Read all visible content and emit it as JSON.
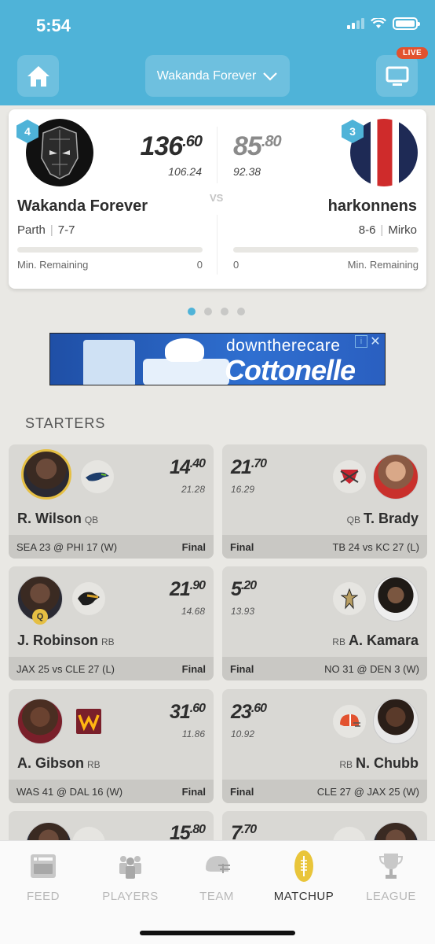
{
  "status": {
    "time": "5:54"
  },
  "header": {
    "team_select": "Wakanda Forever",
    "live_badge": "LIVE"
  },
  "matchup": {
    "vs": "VS",
    "left": {
      "rank": "4",
      "score_int": "136",
      "score_dec": ".60",
      "projected": "106.24",
      "name": "Wakanda Forever",
      "owner": "Parth",
      "record": "7-7",
      "remaining_label": "Min. Remaining",
      "remaining": "0"
    },
    "right": {
      "rank": "3",
      "score_int": "85",
      "score_dec": ".80",
      "projected": "92.38",
      "name": "harkonnens",
      "owner": "Mirko",
      "record": "8-6",
      "remaining_label": "Min. Remaining",
      "remaining": "0"
    }
  },
  "ad": {
    "line1": "downtherecare",
    "line2": "Cottonelle",
    "info": "i",
    "close": "✕"
  },
  "section": {
    "starters": "STARTERS"
  },
  "starters": [
    {
      "left": {
        "name": "R. Wilson",
        "pos": "QB",
        "pts_int": "14",
        "pts_dec": ".40",
        "proj": "21.28",
        "team_logo": "seahawks-logo",
        "game": "SEA 23 @ PHI 17 (W)",
        "status": "Final"
      },
      "right": {
        "name": "T. Brady",
        "pos": "QB",
        "pts_int": "21",
        "pts_dec": ".70",
        "proj": "16.29",
        "team_logo": "buccaneers-logo",
        "game": "TB 24 vs KC 27 (L)",
        "status": "Final"
      }
    },
    {
      "left": {
        "name": "J. Robinson",
        "pos": "RB",
        "pts_int": "21",
        "pts_dec": ".90",
        "proj": "14.68",
        "team_logo": "jaguars-logo",
        "game": "JAX 25 vs CLE 27 (L)",
        "status": "Final",
        "injury": "Q"
      },
      "right": {
        "name": "A. Kamara",
        "pos": "RB",
        "pts_int": "5",
        "pts_dec": ".20",
        "proj": "13.93",
        "team_logo": "saints-logo",
        "game": "NO 31 @ DEN 3 (W)",
        "status": "Final"
      }
    },
    {
      "left": {
        "name": "A. Gibson",
        "pos": "RB",
        "pts_int": "31",
        "pts_dec": ".60",
        "proj": "11.86",
        "team_logo": "washington-logo",
        "game": "WAS 41 @ DAL 16 (W)",
        "status": "Final"
      },
      "right": {
        "name": "N. Chubb",
        "pos": "RB",
        "pts_int": "23",
        "pts_dec": ".60",
        "proj": "10.92",
        "team_logo": "browns-logo",
        "game": "CLE 27 @ JAX 25 (W)",
        "status": "Final"
      }
    },
    {
      "left": {
        "pts_int": "15",
        "pts_dec": ".80"
      },
      "right": {
        "pts_int": "7",
        "pts_dec": ".70"
      }
    }
  ],
  "tabs": [
    {
      "label": "FEED",
      "icon": "feed-icon"
    },
    {
      "label": "PLAYERS",
      "icon": "players-icon"
    },
    {
      "label": "TEAM",
      "icon": "helmet-icon"
    },
    {
      "label": "MATCHUP",
      "icon": "football-icon",
      "active": true
    },
    {
      "label": "LEAGUE",
      "icon": "trophy-icon"
    }
  ],
  "colors": {
    "accent": "#4fb3d8",
    "live": "#e2522f",
    "gold": "#e5bf43"
  }
}
